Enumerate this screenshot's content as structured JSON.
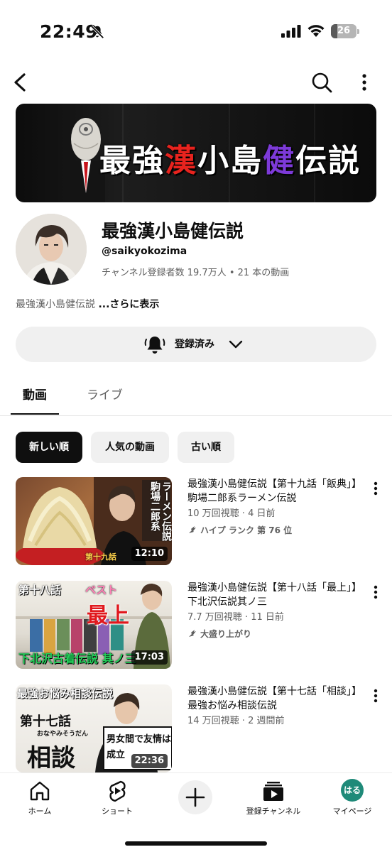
{
  "status_bar": {
    "time": "22:49",
    "battery_level": "26",
    "icons": [
      "bell-slash-icon",
      "cellular-signal-icon",
      "wifi-icon",
      "battery-icon"
    ]
  },
  "top_nav": {
    "icons": [
      "back-arrow-icon",
      "search-icon",
      "more-vertical-icon"
    ]
  },
  "banner": {
    "title_part1": "最強",
    "title_part2": "漢",
    "title_part3": "小島",
    "title_part4": "健",
    "title_part5": "伝説",
    "colors": {
      "accent_red": "#e8231e",
      "accent_purple": "#7d3ad8"
    }
  },
  "channel": {
    "name": "最強漢小島健伝説",
    "handle": "@saikyokozima",
    "stats": "チャンネル登録者数 19.7万人 • 21 本の動画",
    "description": "最強漢小島健伝説 ",
    "description_more": "...さらに表示"
  },
  "subscribe": {
    "label": "登録済み",
    "icons": [
      "bell-icon",
      "chevron-down-icon"
    ]
  },
  "tabs": [
    {
      "label": "動画",
      "selected": true
    },
    {
      "label": "ライブ",
      "selected": false
    }
  ],
  "chips": [
    {
      "label": "新しい順",
      "selected": true
    },
    {
      "label": "人気の動画",
      "selected": false
    },
    {
      "label": "古い順",
      "selected": false
    }
  ],
  "videos": [
    {
      "title": "最強漢小島健伝説【第十九話「飯典」】駒場二郎系ラーメン伝説",
      "meta": "10 万回視聴 · 4 日前",
      "badge": "ハイプ ランク 第 76 位",
      "duration": "12:10",
      "thumb_text_a": "駒場二郎系",
      "thumb_text_b": "ラーメン伝説",
      "thumb_text_c": "第十九話"
    },
    {
      "title": "最強漢小島健伝説【第十八話「最上」】下北沢伝説其ノ三",
      "meta": "7.7 万回視聴 · 11 日前",
      "badge": "大盛り上がり",
      "duration": "17:03",
      "thumb_text_a": "第十八話",
      "thumb_text_b": "ベスト",
      "thumb_text_c": "最上",
      "thumb_text_d": "下北沢古着伝説 其ノ三"
    },
    {
      "title": "最強漢小島健伝説【第十七話「相談」】最強お悩み相談伝説",
      "meta": "14 万回視聴 · 2 週間前",
      "duration": "22:36",
      "thumb_text_a": "最強お悩み相談伝説",
      "thumb_text_b": "第十七話",
      "thumb_text_c": "おなやみそうだん",
      "thumb_text_d": "相談",
      "thumb_text_e": "男女間で友情は",
      "thumb_text_f": "成立"
    }
  ],
  "bottom_nav": [
    {
      "label": "ホーム",
      "icon": "home-icon"
    },
    {
      "label": "ショート",
      "icon": "shorts-icon"
    },
    {
      "label": "",
      "icon": "plus-icon"
    },
    {
      "label": "登録チャンネル",
      "icon": "subscriptions-icon"
    },
    {
      "label": "マイページ",
      "icon": "avatar",
      "avatar_text": "はる"
    }
  ]
}
